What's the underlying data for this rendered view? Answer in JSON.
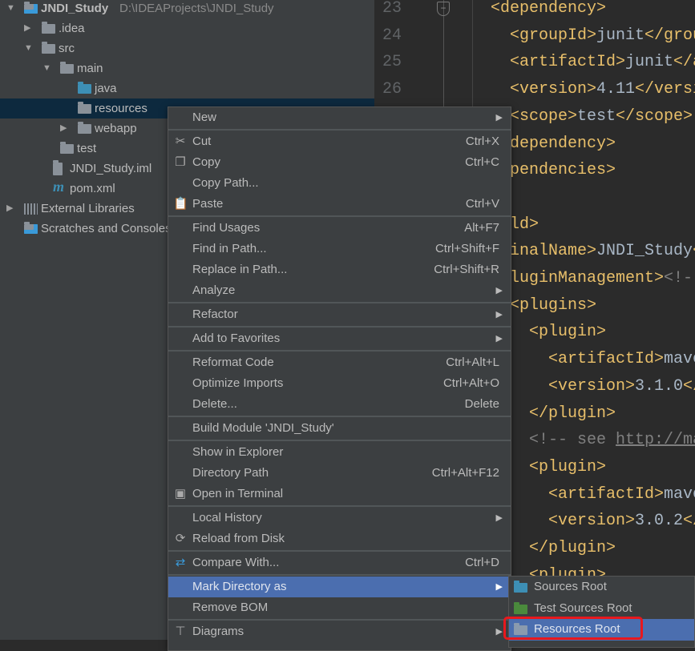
{
  "project_tree": [
    {
      "label": "JNDI_Study",
      "path": "D:\\IDEAProjects\\JNDI_Study",
      "arrow": "▼",
      "icon": "module-folder-icon",
      "level": 0
    },
    {
      "label": ".idea",
      "arrow": "▶",
      "icon": "folder-icon",
      "level": 1
    },
    {
      "label": "src",
      "arrow": "▼",
      "icon": "folder-icon",
      "level": 1
    },
    {
      "label": "main",
      "arrow": "▼",
      "icon": "folder-icon",
      "level": 2
    },
    {
      "label": "java",
      "icon": "source-folder-icon",
      "level": 3
    },
    {
      "label": "resources",
      "icon": "folder-icon",
      "level": 3,
      "selected": true
    },
    {
      "label": "webapp",
      "arrow": "▶",
      "icon": "web-folder-icon",
      "level": 3
    },
    {
      "label": "test",
      "icon": "folder-icon",
      "level": 2
    },
    {
      "label": "JNDI_Study.iml",
      "icon": "iml-file-icon",
      "level": 1.6
    },
    {
      "label": "pom.xml",
      "icon": "maven-icon",
      "level": 1.6
    },
    {
      "label": "External Libraries",
      "arrow": "▶",
      "icon": "libraries-icon",
      "level": 0
    },
    {
      "label": "Scratches and Consoles",
      "icon": "scratches-icon",
      "level": 0
    }
  ],
  "editor": {
    "line_numbers": [
      "23",
      "24",
      "25",
      "26"
    ],
    "lines": [
      {
        "indent": 6,
        "segs": [
          [
            "tag",
            "<dependency>"
          ]
        ]
      },
      {
        "indent": 8,
        "segs": [
          [
            "tag",
            "<groupId>"
          ],
          [
            "txt",
            "junit"
          ],
          [
            "tag",
            "</groupId>"
          ]
        ]
      },
      {
        "indent": 8,
        "segs": [
          [
            "tag",
            "<artifactId>"
          ],
          [
            "txt",
            "junit"
          ],
          [
            "tag",
            "</artifactId>"
          ]
        ]
      },
      {
        "indent": 8,
        "segs": [
          [
            "tag",
            "<version>"
          ],
          [
            "txt",
            "4.11"
          ],
          [
            "tag",
            "</version>"
          ]
        ]
      },
      {
        "indent": 8,
        "segs": [
          [
            "tag",
            "<scope>"
          ],
          [
            "txt",
            "test"
          ],
          [
            "tag",
            "</scope>"
          ]
        ]
      },
      {
        "indent": 6,
        "segs": [
          [
            "tag",
            "</dependency>"
          ]
        ]
      },
      {
        "indent": 4,
        "segs": [
          [
            "tag",
            "</dependencies>"
          ]
        ]
      },
      {
        "indent": 0,
        "segs": []
      },
      {
        "indent": 4,
        "segs": [
          [
            "tag",
            "<build>"
          ]
        ]
      },
      {
        "indent": 6,
        "segs": [
          [
            "tag",
            "<finalName>"
          ],
          [
            "txt",
            "JNDI_Study"
          ],
          [
            "tag",
            "</finalName>"
          ]
        ]
      },
      {
        "indent": 6,
        "segs": [
          [
            "tag",
            "<pluginManagement>"
          ],
          [
            "cmt",
            "<!-- lock down plugins versions -->"
          ]
        ]
      },
      {
        "indent": 8,
        "segs": [
          [
            "tag",
            "<plugins>"
          ]
        ]
      },
      {
        "indent": 10,
        "segs": [
          [
            "tag",
            "<plugin>"
          ]
        ]
      },
      {
        "indent": 12,
        "segs": [
          [
            "tag",
            "<artifactId>"
          ],
          [
            "txt",
            "maven-clean-plugin"
          ],
          [
            "tag",
            "</artifactId>"
          ]
        ]
      },
      {
        "indent": 12,
        "segs": [
          [
            "tag",
            "<version>"
          ],
          [
            "txt",
            "3.1.0"
          ],
          [
            "tag",
            "</version>"
          ]
        ]
      },
      {
        "indent": 10,
        "segs": [
          [
            "tag",
            "</plugin>"
          ]
        ]
      },
      {
        "indent": 10,
        "segs": [
          [
            "cmt",
            "<!-- see "
          ],
          [
            "url",
            "http://maven.apache.org"
          ]
        ]
      },
      {
        "indent": 10,
        "segs": [
          [
            "tag",
            "<plugin>"
          ]
        ]
      },
      {
        "indent": 12,
        "segs": [
          [
            "tag",
            "<artifactId>"
          ],
          [
            "txt",
            "maven-resources-plugin"
          ],
          [
            "tag",
            "</artifactId>"
          ]
        ]
      },
      {
        "indent": 12,
        "segs": [
          [
            "tag",
            "<version>"
          ],
          [
            "txt",
            "3.0.2"
          ],
          [
            "tag",
            "</version>"
          ]
        ]
      },
      {
        "indent": 10,
        "segs": [
          [
            "tag",
            "</plugin>"
          ]
        ]
      },
      {
        "indent": 10,
        "segs": [
          [
            "tag",
            "<plugin>"
          ]
        ]
      }
    ]
  },
  "context_menu": [
    {
      "label": "New",
      "submenu": true
    },
    {
      "sep": true
    },
    {
      "label": "Cut",
      "shortcut": "Ctrl+X",
      "icon": "scissors-icon"
    },
    {
      "label": "Copy",
      "shortcut": "Ctrl+C",
      "icon": "copy-icon"
    },
    {
      "label": "Copy Path..."
    },
    {
      "label": "Paste",
      "shortcut": "Ctrl+V",
      "icon": "clipboard-icon"
    },
    {
      "sep": true
    },
    {
      "label": "Find Usages",
      "shortcut": "Alt+F7"
    },
    {
      "label": "Find in Path...",
      "shortcut": "Ctrl+Shift+F"
    },
    {
      "label": "Replace in Path...",
      "shortcut": "Ctrl+Shift+R"
    },
    {
      "label": "Analyze",
      "submenu": true
    },
    {
      "sep": true
    },
    {
      "label": "Refactor",
      "submenu": true
    },
    {
      "sep": true
    },
    {
      "label": "Add to Favorites",
      "submenu": true
    },
    {
      "sep": true
    },
    {
      "label": "Reformat Code",
      "shortcut": "Ctrl+Alt+L"
    },
    {
      "label": "Optimize Imports",
      "shortcut": "Ctrl+Alt+O"
    },
    {
      "label": "Delete...",
      "shortcut": "Delete"
    },
    {
      "sep": true
    },
    {
      "label": "Build Module 'JNDI_Study'"
    },
    {
      "sep": true
    },
    {
      "label": "Show in Explorer"
    },
    {
      "label": "Directory Path",
      "shortcut": "Ctrl+Alt+F12"
    },
    {
      "label": "Open in Terminal",
      "icon": "terminal-icon"
    },
    {
      "sep": true
    },
    {
      "label": "Local History",
      "submenu": true
    },
    {
      "label": "Reload from Disk",
      "icon": "reload-icon"
    },
    {
      "sep": true
    },
    {
      "label": "Compare With...",
      "shortcut": "Ctrl+D",
      "icon": "compare-icon"
    },
    {
      "sep": true
    },
    {
      "label": "Mark Directory as",
      "submenu": true,
      "selected": true
    },
    {
      "label": "Remove BOM"
    },
    {
      "sep": true
    },
    {
      "label": "Diagrams",
      "submenu": true,
      "icon": "diagram-icon"
    }
  ],
  "submenu": [
    {
      "label": "Sources Root",
      "icon": "source-folder-icon",
      "color": "#3d8fb5"
    },
    {
      "label": "Test Sources Root",
      "icon": "test-folder-icon",
      "color": "#4a8a3c"
    },
    {
      "label": "Resources Root",
      "icon": "resources-folder-icon",
      "color": "#8a9aae",
      "selected": true
    }
  ],
  "colors": {
    "selection": "#4b6eaf",
    "highlight_box": "#e8181d",
    "tag": "#e8bf6a",
    "tree_selection": "#0d293e"
  }
}
